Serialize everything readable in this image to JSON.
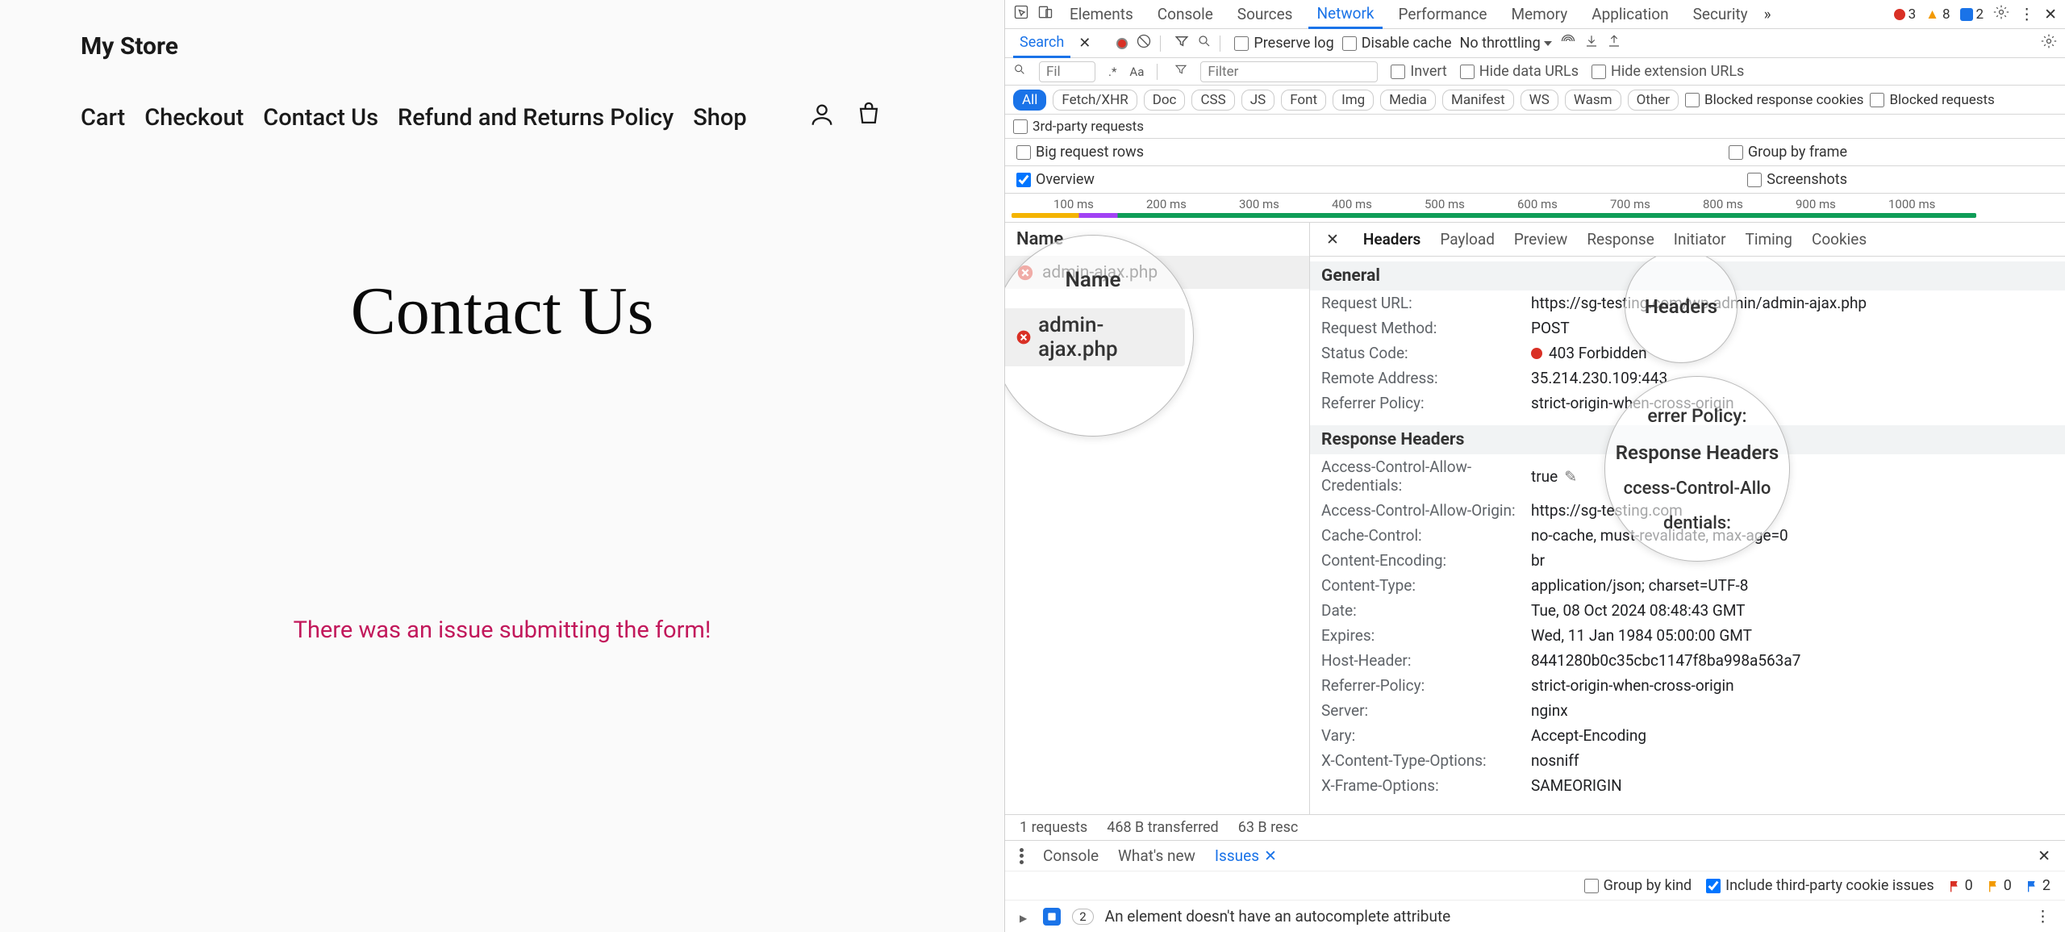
{
  "site": {
    "title": "My Store",
    "nav": [
      "Cart",
      "Checkout",
      "Contact Us",
      "Refund and Returns Policy",
      "Shop"
    ],
    "page_heading": "Contact Us",
    "error_message": "There was an issue submitting the form!"
  },
  "devtools": {
    "main_tabs": [
      "Elements",
      "Console",
      "Sources",
      "Network",
      "Performance",
      "Memory",
      "Application",
      "Security"
    ],
    "active_main_tab": "Network",
    "warn_counts": {
      "errors": "3",
      "warnings": "8",
      "info": "2"
    },
    "toolbar": {
      "search_label": "Search",
      "preserve_log": "Preserve log",
      "disable_cache": "Disable cache",
      "throttling": "No throttling"
    },
    "filter": {
      "placeholder_small": "Fil",
      "placeholder_filter": "Filter",
      "invert": "Invert",
      "hide_data": "Hide data URLs",
      "hide_ext": "Hide extension URLs"
    },
    "type_chips": [
      "All",
      "Fetch/XHR",
      "Doc",
      "CSS",
      "JS",
      "Font",
      "Img",
      "Media",
      "Manifest",
      "WS",
      "Wasm",
      "Other"
    ],
    "blocked_cookies": "Blocked response cookies",
    "blocked_requests": "Blocked requests",
    "third_party": "3rd-party requests",
    "options": {
      "big_rows": "Big request rows",
      "overview": "Overview",
      "group_frame": "Group by frame",
      "screenshots": "Screenshots"
    },
    "timeline_ticks": [
      "100 ms",
      "200 ms",
      "300 ms",
      "400 ms",
      "500 ms",
      "600 ms",
      "700 ms",
      "800 ms",
      "900 ms",
      "1000 ms"
    ],
    "name_header": "Name",
    "request_name": "admin-ajax.php",
    "detail_tabs": [
      "Headers",
      "Payload",
      "Preview",
      "Response",
      "Initiator",
      "Timing",
      "Cookies"
    ],
    "general": {
      "title": "General",
      "rows": [
        {
          "k": "Request URL:",
          "v": "https://sg-testing.com/wp-admin/admin-ajax.php"
        },
        {
          "k": "Request Method:",
          "v": "POST"
        },
        {
          "k": "Status Code:",
          "v": "403 Forbidden",
          "status": true
        },
        {
          "k": "Remote Address:",
          "v": "35.214.230.109:443"
        },
        {
          "k": "Referrer Policy:",
          "v": "strict-origin-when-cross-origin"
        }
      ]
    },
    "response_headers": {
      "title": "Response Headers",
      "rows": [
        {
          "k": "Access-Control-Allow-Credentials:",
          "v": "true",
          "edit": true
        },
        {
          "k": "Access-Control-Allow-Origin:",
          "v": "https://sg-testing.com"
        },
        {
          "k": "Cache-Control:",
          "v": "no-cache, must-revalidate, max-age=0"
        },
        {
          "k": "Content-Encoding:",
          "v": "br"
        },
        {
          "k": "Content-Type:",
          "v": "application/json; charset=UTF-8"
        },
        {
          "k": "Date:",
          "v": "Tue, 08 Oct 2024 08:48:43 GMT"
        },
        {
          "k": "Expires:",
          "v": "Wed, 11 Jan 1984 05:00:00 GMT"
        },
        {
          "k": "Host-Header:",
          "v": "8441280b0c35cbc1147f8ba998a563a7"
        },
        {
          "k": "Referrer-Policy:",
          "v": "strict-origin-when-cross-origin"
        },
        {
          "k": "Server:",
          "v": "nginx"
        },
        {
          "k": "Vary:",
          "v": "Accept-Encoding"
        },
        {
          "k": "X-Content-Type-Options:",
          "v": "nosniff"
        },
        {
          "k": "X-Frame-Options:",
          "v": "SAMEORIGIN"
        }
      ]
    },
    "status": {
      "requests": "1 requests",
      "transferred": "468 B transferred",
      "resources": "63 B resc"
    },
    "drawer": {
      "tabs": [
        "Console",
        "What's new",
        "Issues"
      ],
      "group_kind": "Group by kind",
      "include_3p": "Include third-party cookie issues",
      "flags": {
        "red": "0",
        "orange": "0",
        "blue": "2"
      },
      "issue_count": "2",
      "issue_text": "An element doesn't have an autocomplete attribute"
    },
    "magnifiers": {
      "m1_line1": "Name",
      "m1_line2": "admin-ajax.php",
      "m2": "Headers",
      "m3a": "Response Headers",
      "m3b": "ccess-Control-Allo",
      "m3c": "dentials:",
      "m3d": "errer Policy:"
    }
  }
}
